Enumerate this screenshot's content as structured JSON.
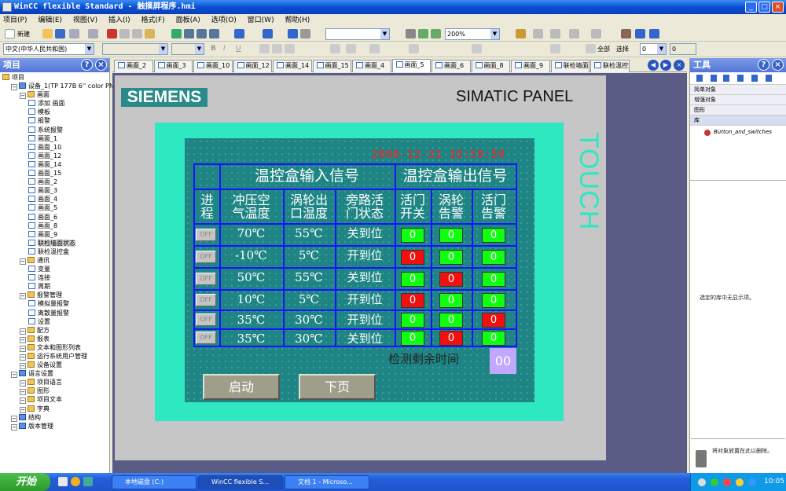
{
  "window": {
    "title": "WinCC flexible Standard - 触摸屏程序.hmi",
    "minimize": "_",
    "maximize": "□",
    "close": "×"
  },
  "menu": [
    "项目(P)",
    "编辑(E)",
    "视图(V)",
    "插入(I)",
    "格式(F)",
    "面板(A)",
    "选项(O)",
    "窗口(W)",
    "帮助(H)"
  ],
  "toolbar": {
    "new_label": "新建",
    "zoom": "200%",
    "language": "中文(中华人民共和国)",
    "all_label": "全部",
    "select_label": "选择",
    "num1": "0",
    "num2": "0"
  },
  "project_panel": {
    "title": "项目",
    "tree": [
      {
        "label": "项目",
        "level": 0
      },
      {
        "label": "设备_1(TP 177B 6'' color PN/DP)",
        "level": 1
      },
      {
        "label": "画面",
        "level": 2
      },
      {
        "label": "添加 画面",
        "level": 3
      },
      {
        "label": "模板",
        "level": 3
      },
      {
        "label": "报警",
        "level": 3
      },
      {
        "label": "系统报警",
        "level": 3
      },
      {
        "label": "画面_1",
        "level": 3
      },
      {
        "label": "画面_10",
        "level": 3
      },
      {
        "label": "画面_12",
        "level": 3
      },
      {
        "label": "画面_14",
        "level": 3
      },
      {
        "label": "画面_15",
        "level": 3
      },
      {
        "label": "画面_2",
        "level": 3
      },
      {
        "label": "画面_3",
        "level": 3
      },
      {
        "label": "画面_4",
        "level": 3
      },
      {
        "label": "画面_5",
        "level": 3
      },
      {
        "label": "画面_6",
        "level": 3
      },
      {
        "label": "画面_8",
        "level": 3
      },
      {
        "label": "画面_9",
        "level": 3
      },
      {
        "label": "联检墙面状态",
        "level": 3,
        "selected": true
      },
      {
        "label": "联检温控盒",
        "level": 3
      },
      {
        "label": "通讯",
        "level": 2
      },
      {
        "label": "变量",
        "level": 3
      },
      {
        "label": "连接",
        "level": 3
      },
      {
        "label": "周期",
        "level": 3
      },
      {
        "label": "报警管理",
        "level": 2
      },
      {
        "label": "模拟量报警",
        "level": 3
      },
      {
        "label": "离散量报警",
        "level": 3
      },
      {
        "label": "设置",
        "level": 3
      },
      {
        "label": "配方",
        "level": 2
      },
      {
        "label": "报表",
        "level": 2
      },
      {
        "label": "文本和图形列表",
        "level": 2
      },
      {
        "label": "运行系统用户管理",
        "level": 2
      },
      {
        "label": "设备设置",
        "level": 2
      },
      {
        "label": "语言设置",
        "level": 1
      },
      {
        "label": "项目语言",
        "level": 2
      },
      {
        "label": "图形",
        "level": 2
      },
      {
        "label": "项目文本",
        "level": 2
      },
      {
        "label": "字典",
        "level": 2
      },
      {
        "label": "结构",
        "level": 1
      },
      {
        "label": "版本管理",
        "level": 1
      }
    ]
  },
  "tabs": [
    "画面_2",
    "画面_3",
    "画面_10",
    "画面_12",
    "画面_14",
    "画面_15",
    "画面_4",
    "画面_5",
    "画面_6",
    "画面_8",
    "画面_9",
    "联检墙面状态",
    "联检温控盒"
  ],
  "active_tab": "画面_5",
  "panel": {
    "brand": "SIEMENS",
    "model": "SIMATIC PANEL",
    "touch": "TOUCH"
  },
  "hmi": {
    "datetime": "2000-12-31  10:59:59",
    "header_input": "温控盒输入信号",
    "header_output": "温控盒输出信号",
    "col_headers": [
      "进\n程",
      "冲压空\n气温度",
      "涡轮出\n口温度",
      "旁路活\n门状态",
      "活门\n开关",
      "涡轮\n告警",
      "活门\n告警"
    ],
    "rows": [
      {
        "proc": "OFF",
        "air": "70℃",
        "turbine": "55℃",
        "bypass": "关到位",
        "s1": "0",
        "s1c": "g",
        "s2": "0",
        "s2c": "g",
        "s3": "0",
        "s3c": "g"
      },
      {
        "proc": "OFF",
        "air": "-10℃",
        "turbine": "5℃",
        "bypass": "开到位",
        "s1": "0",
        "s1c": "r",
        "s2": "0",
        "s2c": "g",
        "s3": "0",
        "s3c": "g"
      },
      {
        "proc": "OFF",
        "air": "50℃",
        "turbine": "55℃",
        "bypass": "关到位",
        "s1": "0",
        "s1c": "g",
        "s2": "0",
        "s2c": "r",
        "s3": "0",
        "s3c": "g"
      },
      {
        "proc": "OFF",
        "air": "10℃",
        "turbine": "5℃",
        "bypass": "开到位",
        "s1": "0",
        "s1c": "r",
        "s2": "0",
        "s2c": "g",
        "s3": "0",
        "s3c": "g"
      },
      {
        "proc": "OFF",
        "air": "35℃",
        "turbine": "30℃",
        "bypass": "开到位",
        "s1": "0",
        "s1c": "g",
        "s2": "0",
        "s2c": "g",
        "s3": "0",
        "s3c": "r"
      },
      {
        "proc": "OFF",
        "air": "35℃",
        "turbine": "30℃",
        "bypass": "关到位",
        "s1": "0",
        "s1c": "g",
        "s2": "0",
        "s2c": "r",
        "s3": "0",
        "s3c": "g"
      }
    ],
    "count_label": "检测剩余时间",
    "count_value": "00",
    "start_button": "启动",
    "next_button": "下页"
  },
  "tools_panel": {
    "title": "工具",
    "rows": [
      "简单对象",
      "增强对象",
      "图形",
      "库"
    ],
    "library_item": "Button_and_switches",
    "note": "选定的库中无显示项。",
    "drop_note": "将对象放置在此以删除。"
  },
  "taskbar": {
    "start": "开始",
    "tasks": [
      "本地磁盘 (C:)",
      "WinCC flexible S...",
      "文档 1 - Microso..."
    ],
    "clock": "10:05"
  }
}
